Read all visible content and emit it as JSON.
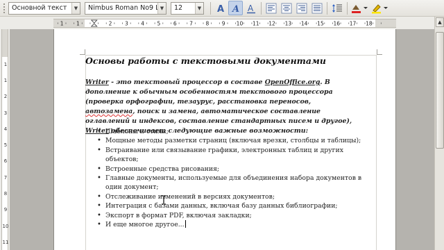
{
  "toolbar": {
    "paragraph_style": "Основной текст",
    "font_name": "Nimbus Roman No9 L",
    "font_size": "12",
    "buttons": [
      "bold",
      "italic",
      "underline",
      "align-left",
      "align-center",
      "align-right",
      "justify",
      "line-spacing",
      "highlight",
      "char-color"
    ]
  },
  "ruler": {
    "labels": [
      "1",
      "1",
      "1",
      "2",
      "3",
      "4",
      "5",
      "6",
      "7",
      "8",
      "9",
      "10",
      "11",
      "12",
      "13",
      "14",
      "15",
      "16",
      "17",
      "18"
    ],
    "vertical_labels": [
      "1",
      "1",
      "2",
      "3",
      "4",
      "5",
      "6",
      "7",
      "8",
      "9",
      "10",
      "11"
    ]
  },
  "document": {
    "title": "Основы работы с текстовыми документами",
    "intro_writer": "Writer",
    "intro_part1": " - это текстовый процессор в составе ",
    "intro_oo": "OpenOffice.org",
    "intro_part2": ". В дополнение к обычным особенностям текстового процессора (проверка орфографии, тезаурус, расстановка переносов, ",
    "intro_autozamena": "автозамена",
    "intro_part3": ", поиск и замена, автоматическое составление оглавлений и индексов, составление стандартных писем и другое), ",
    "intro_writer2": "Writer",
    "intro_part4": " обеспечивает следующие важные возможности:",
    "items": [
      "Шаблоны и стили;",
      "Мощные методы разметки страниц (включая врезки, столбцы и таблицы);",
      "Встраивание или связывание графики, электронных таблиц и других объектов;",
      "Встроенные средства рисования;",
      "Главные документы, используемые для объединения набора документов в один документ;",
      "Отслеживание изменений в версиях документов;",
      "Интеграция с базами данных, включая базу данных библиографии;",
      "Экспорт в формат PDF, включая закладки;",
      "И еще многое другое..."
    ]
  },
  "colors": {
    "active_button": "#c4d3ea",
    "workspace": "#b5b3ae",
    "spellcheck": "#dd3333"
  }
}
